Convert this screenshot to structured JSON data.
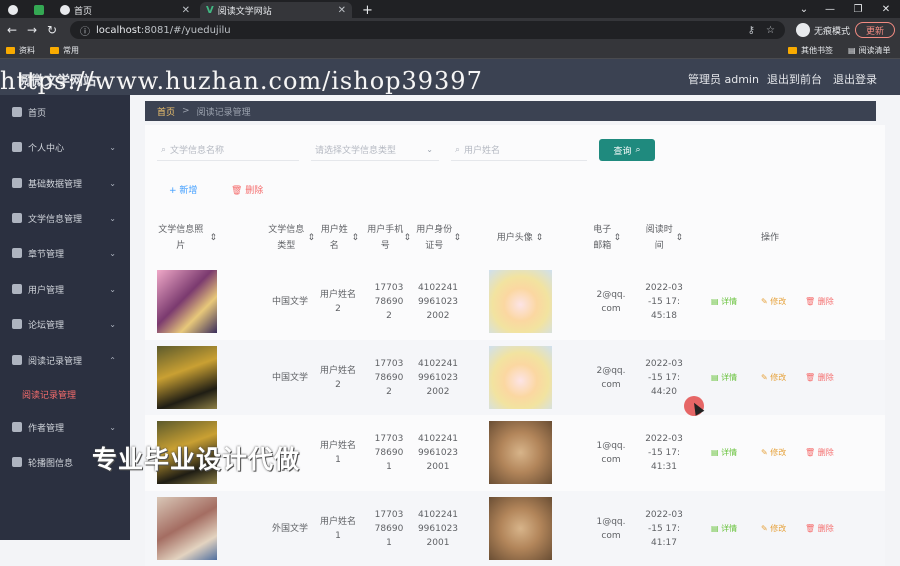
{
  "browser": {
    "tabs": [
      {
        "title": "",
        "icon": "globe-icon"
      },
      {
        "title": "",
        "icon": "green-app-icon"
      },
      {
        "title": "首页",
        "icon": "globe-icon"
      },
      {
        "title": "阅读文学网站",
        "icon": "vue-logo-icon"
      }
    ],
    "url_host": "localhost",
    "url_rest": ":8081/#/yuedujilu",
    "incognito_label": "无痕模式",
    "update_label": "更新",
    "bookmarks": [
      "资料",
      "常用",
      "其他书签",
      "阅读清单"
    ]
  },
  "header": {
    "site_title": "阅微文学网站",
    "admin_label": "管理员 admin",
    "back_front_label": "退出到前台",
    "logout_label": "退出登录"
  },
  "watermarks": {
    "url_text": "https://www.huzhan.com/ishop39397",
    "cn_text": "专业毕业设计代做"
  },
  "sidebar": {
    "items": [
      {
        "label": "首页",
        "icon": "home-icon",
        "has_children": false
      },
      {
        "label": "个人中心",
        "icon": "user-icon",
        "has_children": true
      },
      {
        "label": "基础数据管理",
        "icon": "data-icon",
        "has_children": true
      },
      {
        "label": "文学信息管理",
        "icon": "book-icon",
        "has_children": true
      },
      {
        "label": "章节管理",
        "icon": "chapter-icon",
        "has_children": true
      },
      {
        "label": "用户管理",
        "icon": "users-icon",
        "has_children": true
      },
      {
        "label": "论坛管理",
        "icon": "forum-icon",
        "has_children": true
      },
      {
        "label": "阅读记录管理",
        "icon": "record-icon",
        "has_children": true
      },
      {
        "label": "作者管理",
        "icon": "author-icon",
        "has_children": true
      },
      {
        "label": "轮播图信息",
        "icon": "carousel-icon",
        "has_children": false
      }
    ],
    "active_sub": "阅读记录管理"
  },
  "breadcrumb": {
    "home": "首页",
    "current": "阅读记录管理"
  },
  "filters": {
    "name_placeholder": "文学信息名称",
    "type_placeholder": "请选择文学信息类型",
    "user_placeholder": "用户姓名",
    "query_label": "查询"
  },
  "actions": {
    "add_label": "新增",
    "delete_label": "删除"
  },
  "table": {
    "headers": [
      "文学信息照片",
      "文学信息类型",
      "用户姓名",
      "用户手机号",
      "用户身份证号",
      "用户头像",
      "电子邮箱",
      "阅读时间",
      "操作"
    ],
    "row_ops": {
      "detail": "详情",
      "edit": "修改",
      "remove": "删除"
    },
    "rows": [
      {
        "cover": "cover-a",
        "type": "中国文学",
        "user": "用户姓名2",
        "phone": "17703786902",
        "idcard": "410224199610232002",
        "avatar": "av-anime",
        "email": "2@qq.com",
        "time": "2022-03-15 17:45:18"
      },
      {
        "cover": "cover-b",
        "type": "中国文学",
        "user": "用户姓名2",
        "phone": "17703786902",
        "idcard": "410224199610232002",
        "avatar": "av-anime",
        "email": "2@qq.com",
        "time": "2022-03-15 17:44:20"
      },
      {
        "cover": "cover-b",
        "type": "",
        "user": "用户姓名1",
        "phone": "17703786901",
        "idcard": "410224199610232001",
        "avatar": "av-dog",
        "email": "1@qq.com",
        "time": "2022-03-15 17:41:31"
      },
      {
        "cover": "cover-c",
        "type": "外国文学",
        "user": "用户姓名1",
        "phone": "17703786901",
        "idcard": "410224199610232001",
        "avatar": "av-dog",
        "email": "1@qq.com",
        "time": "2022-03-15 17:41:17"
      }
    ]
  }
}
